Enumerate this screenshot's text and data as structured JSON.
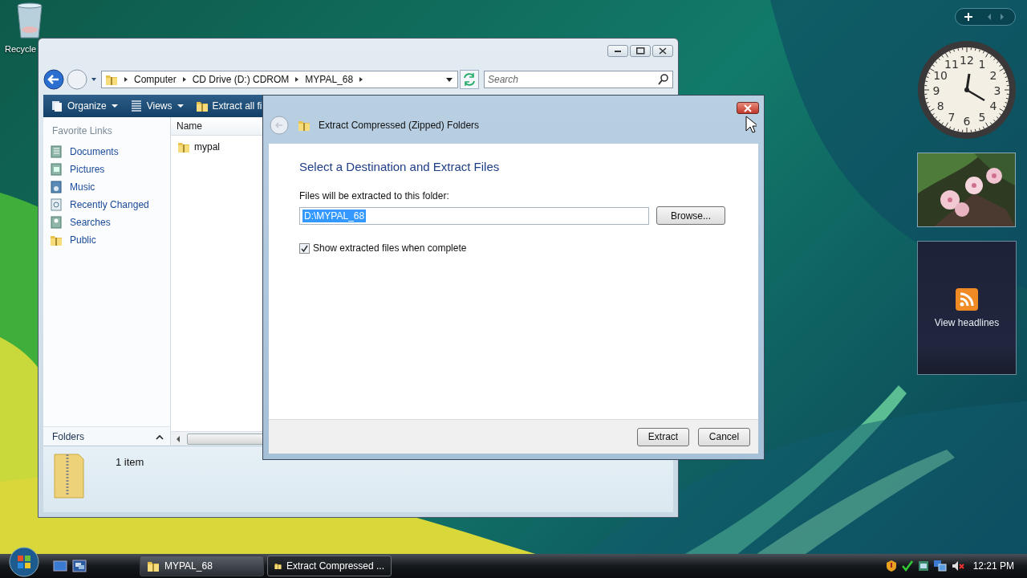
{
  "desktop": {
    "icons": [
      {
        "label": "Recycle"
      }
    ]
  },
  "explorer": {
    "breadcrumb": [
      "Computer",
      "CD Drive (D:) CDROM",
      "MYPAL_68"
    ],
    "search": {
      "placeholder": "Search"
    },
    "toolbar": [
      {
        "kind": "organize",
        "label": "Organize"
      },
      {
        "kind": "views",
        "label": "Views"
      },
      {
        "kind": "extract",
        "label": "Extract all fi"
      }
    ],
    "favorite_links": {
      "heading": "Favorite Links",
      "items": [
        {
          "kind": "documents",
          "label": "Documents"
        },
        {
          "kind": "pictures",
          "label": "Pictures"
        },
        {
          "kind": "music",
          "label": "Music"
        },
        {
          "kind": "recent",
          "label": "Recently Changed"
        },
        {
          "kind": "searches",
          "label": "Searches"
        },
        {
          "kind": "public",
          "label": "Public"
        }
      ]
    },
    "folders_bar": {
      "label": "Folders"
    },
    "columns": [
      "Name"
    ],
    "files": [
      {
        "name": "mypal"
      }
    ],
    "details": {
      "count": "1 item"
    }
  },
  "dialog": {
    "title": "Extract Compressed (Zipped) Folders",
    "heading": "Select a Destination and Extract Files",
    "field_label": "Files will be extracted to this folder:",
    "path": {
      "value": "D:\\MYPAL_68",
      "text_selected": true
    },
    "browse": "Browse...",
    "show_files": {
      "label": "Show extracted files when complete",
      "checked": true
    },
    "buttons": [
      "Extract",
      "Cancel"
    ]
  },
  "gadgets": {
    "clock": {
      "numerals": [
        "11",
        "12",
        "1",
        "10",
        "2",
        "9",
        "3",
        "8",
        "4",
        "7",
        "6",
        "5"
      ]
    },
    "feed": {
      "label": "View headlines"
    }
  },
  "taskbar": {
    "tasks": [
      {
        "label": "MYPAL_68",
        "selected": false
      },
      {
        "label": "Extract Compressed ...",
        "selected": true
      }
    ],
    "time": "12:21 PM"
  }
}
